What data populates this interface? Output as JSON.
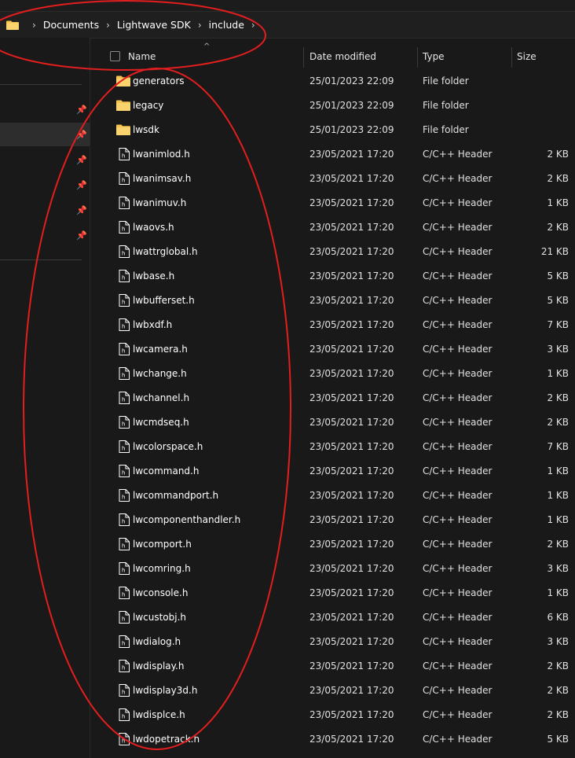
{
  "breadcrumb": [
    "Documents",
    "Lightwave SDK",
    "include"
  ],
  "columns": {
    "name": "Name",
    "date": "Date modified",
    "type": "Type",
    "size": "Size"
  },
  "files": [
    {
      "name": "generators",
      "date": "25/01/2023 22:09",
      "type": "File folder",
      "size": "",
      "kind": "folder"
    },
    {
      "name": "legacy",
      "date": "25/01/2023 22:09",
      "type": "File folder",
      "size": "",
      "kind": "folder"
    },
    {
      "name": "lwsdk",
      "date": "25/01/2023 22:09",
      "type": "File folder",
      "size": "",
      "kind": "folder"
    },
    {
      "name": "lwanimlod.h",
      "date": "23/05/2021 17:20",
      "type": "C/C++ Header",
      "size": "2 KB",
      "kind": "file"
    },
    {
      "name": "lwanimsav.h",
      "date": "23/05/2021 17:20",
      "type": "C/C++ Header",
      "size": "2 KB",
      "kind": "file"
    },
    {
      "name": "lwanimuv.h",
      "date": "23/05/2021 17:20",
      "type": "C/C++ Header",
      "size": "1 KB",
      "kind": "file"
    },
    {
      "name": "lwaovs.h",
      "date": "23/05/2021 17:20",
      "type": "C/C++ Header",
      "size": "2 KB",
      "kind": "file"
    },
    {
      "name": "lwattrglobal.h",
      "date": "23/05/2021 17:20",
      "type": "C/C++ Header",
      "size": "21 KB",
      "kind": "file"
    },
    {
      "name": "lwbase.h",
      "date": "23/05/2021 17:20",
      "type": "C/C++ Header",
      "size": "5 KB",
      "kind": "file"
    },
    {
      "name": "lwbufferset.h",
      "date": "23/05/2021 17:20",
      "type": "C/C++ Header",
      "size": "5 KB",
      "kind": "file"
    },
    {
      "name": "lwbxdf.h",
      "date": "23/05/2021 17:20",
      "type": "C/C++ Header",
      "size": "7 KB",
      "kind": "file"
    },
    {
      "name": "lwcamera.h",
      "date": "23/05/2021 17:20",
      "type": "C/C++ Header",
      "size": "3 KB",
      "kind": "file"
    },
    {
      "name": "lwchange.h",
      "date": "23/05/2021 17:20",
      "type": "C/C++ Header",
      "size": "1 KB",
      "kind": "file"
    },
    {
      "name": "lwchannel.h",
      "date": "23/05/2021 17:20",
      "type": "C/C++ Header",
      "size": "2 KB",
      "kind": "file"
    },
    {
      "name": "lwcmdseq.h",
      "date": "23/05/2021 17:20",
      "type": "C/C++ Header",
      "size": "2 KB",
      "kind": "file"
    },
    {
      "name": "lwcolorspace.h",
      "date": "23/05/2021 17:20",
      "type": "C/C++ Header",
      "size": "7 KB",
      "kind": "file"
    },
    {
      "name": "lwcommand.h",
      "date": "23/05/2021 17:20",
      "type": "C/C++ Header",
      "size": "1 KB",
      "kind": "file"
    },
    {
      "name": "lwcommandport.h",
      "date": "23/05/2021 17:20",
      "type": "C/C++ Header",
      "size": "1 KB",
      "kind": "file"
    },
    {
      "name": "lwcomponenthandler.h",
      "date": "23/05/2021 17:20",
      "type": "C/C++ Header",
      "size": "1 KB",
      "kind": "file"
    },
    {
      "name": "lwcomport.h",
      "date": "23/05/2021 17:20",
      "type": "C/C++ Header",
      "size": "2 KB",
      "kind": "file"
    },
    {
      "name": "lwcomring.h",
      "date": "23/05/2021 17:20",
      "type": "C/C++ Header",
      "size": "3 KB",
      "kind": "file"
    },
    {
      "name": "lwconsole.h",
      "date": "23/05/2021 17:20",
      "type": "C/C++ Header",
      "size": "1 KB",
      "kind": "file"
    },
    {
      "name": "lwcustobj.h",
      "date": "23/05/2021 17:20",
      "type": "C/C++ Header",
      "size": "6 KB",
      "kind": "file"
    },
    {
      "name": "lwdialog.h",
      "date": "23/05/2021 17:20",
      "type": "C/C++ Header",
      "size": "3 KB",
      "kind": "file"
    },
    {
      "name": "lwdisplay.h",
      "date": "23/05/2021 17:20",
      "type": "C/C++ Header",
      "size": "2 KB",
      "kind": "file"
    },
    {
      "name": "lwdisplay3d.h",
      "date": "23/05/2021 17:20",
      "type": "C/C++ Header",
      "size": "2 KB",
      "kind": "file"
    },
    {
      "name": "lwdisplce.h",
      "date": "23/05/2021 17:20",
      "type": "C/C++ Header",
      "size": "2 KB",
      "kind": "file"
    },
    {
      "name": "lwdopetrack.h",
      "date": "23/05/2021 17:20",
      "type": "C/C++ Header",
      "size": "5 KB",
      "kind": "file"
    }
  ],
  "colors": {
    "folder": "#f5c451",
    "annotation": "#e31e1e"
  }
}
